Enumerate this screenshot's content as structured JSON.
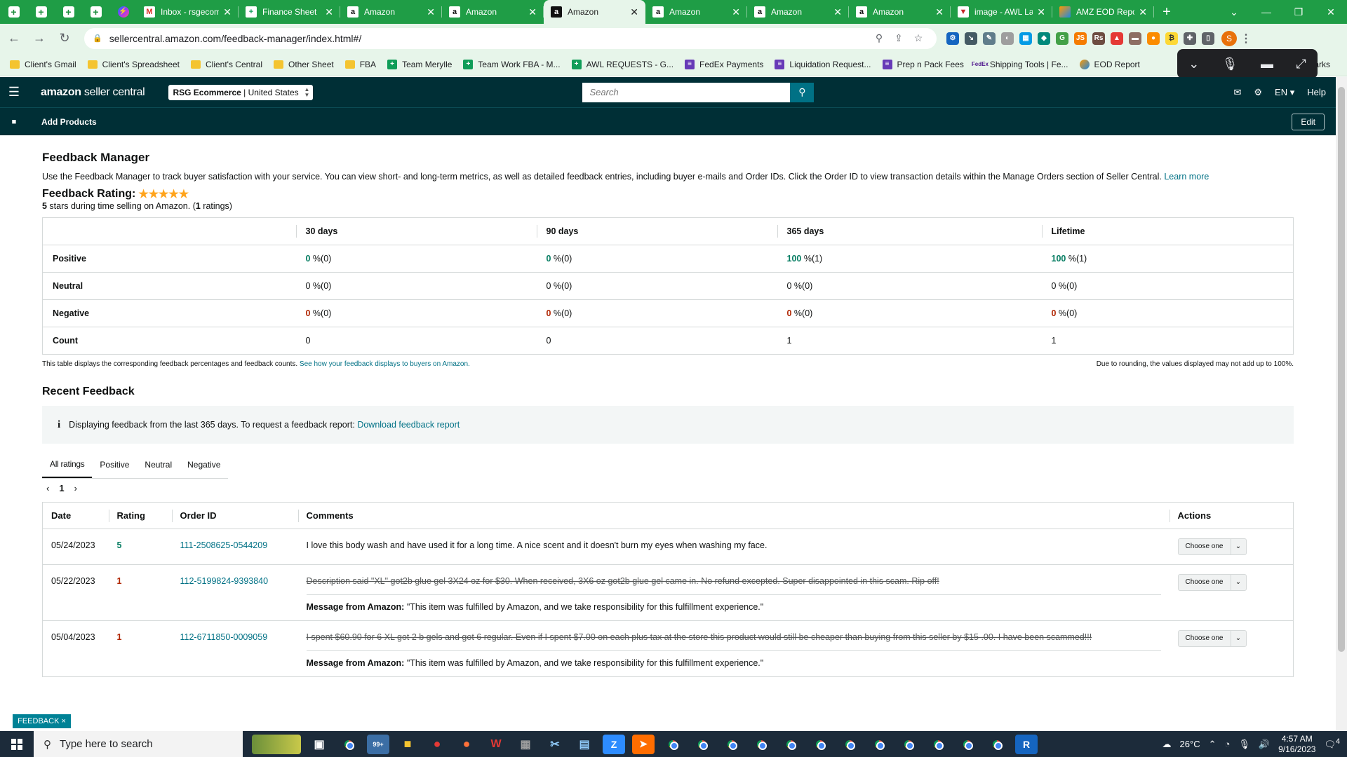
{
  "browser": {
    "pinned_tabs": [
      "sheet",
      "sheet",
      "sheet",
      "sheet",
      "messenger"
    ],
    "tabs": [
      {
        "title": "Inbox - rsgecom",
        "favicon": "gmail",
        "active": false
      },
      {
        "title": "Finance Sheet",
        "favicon": "sheet",
        "active": false
      },
      {
        "title": "Amazon",
        "favicon": "amazon",
        "active": false
      },
      {
        "title": "Amazon",
        "favicon": "amazon",
        "active": false
      },
      {
        "title": "Amazon",
        "favicon": "amazon",
        "active": true
      },
      {
        "title": "Amazon",
        "favicon": "amazon",
        "active": false
      },
      {
        "title": "Amazon",
        "favicon": "amazon",
        "active": false
      },
      {
        "title": "Amazon",
        "favicon": "amazon",
        "active": false
      },
      {
        "title": "image - AWL Labs",
        "favicon": "awl",
        "active": false
      },
      {
        "title": "AMZ EOD Report",
        "favicon": "multi",
        "active": false
      }
    ],
    "url": "sellercentral.amazon.com/feedback-manager/index.html#/",
    "profile_initial": "S",
    "bookmarks": [
      {
        "label": "Client's Gmail",
        "icon": "folder"
      },
      {
        "label": "Client's Spreadsheet",
        "icon": "folder"
      },
      {
        "label": "Client's Central",
        "icon": "folder"
      },
      {
        "label": "Other Sheet",
        "icon": "folder"
      },
      {
        "label": "FBA",
        "icon": "folder"
      },
      {
        "label": "Team Merylle",
        "icon": "sheet"
      },
      {
        "label": "Team Work FBA - M...",
        "icon": "sheet"
      },
      {
        "label": "AWL REQUESTS - G...",
        "icon": "sheet"
      },
      {
        "label": "FedEx Payments",
        "icon": "form"
      },
      {
        "label": "Liquidation Request...",
        "icon": "form"
      },
      {
        "label": "Prep n Pack Fees",
        "icon": "form"
      },
      {
        "label": "Shipping Tools | Fe...",
        "icon": "fedex"
      },
      {
        "label": "EOD Report",
        "icon": "eod"
      }
    ],
    "bookmarks_overflow": "marks"
  },
  "header": {
    "logo_bold": "amazon",
    "logo_rest": " seller central",
    "store": "RSG Ecommerce",
    "marketplace": "United States",
    "search_placeholder": "Search",
    "language": "EN",
    "help": "Help",
    "add_products": "Add Products",
    "edit": "Edit"
  },
  "feedback_manager": {
    "title": "Feedback Manager",
    "description": "Use the Feedback Manager to track buyer satisfaction with your service. You can view short- and long-term metrics, as well as detailed feedback entries, including buyer e-mails and Order IDs. Click the Order ID to view transaction details within the Manage Orders section of Seller Central.",
    "learn_more": "Learn more",
    "rating_label": "Feedback Rating:",
    "stars": "★★★★★",
    "rating_value": "5",
    "rating_mid": " stars during time selling on Amazon. (",
    "rating_count": "1",
    "rating_end": " ratings)",
    "columns": [
      "30 days",
      "90 days",
      "365 days",
      "Lifetime"
    ],
    "rows": [
      {
        "label": "Positive",
        "tone": "pos",
        "cells": [
          {
            "v": "0",
            "s": " %(0)"
          },
          {
            "v": "0",
            "s": " %(0)"
          },
          {
            "v": "100",
            "s": " %(1)"
          },
          {
            "v": "100",
            "s": " %(1)"
          }
        ]
      },
      {
        "label": "Neutral",
        "tone": "plain",
        "cells": [
          {
            "v": "0",
            "s": " %(0)"
          },
          {
            "v": "0",
            "s": " %(0)"
          },
          {
            "v": "0",
            "s": " %(0)"
          },
          {
            "v": "0",
            "s": " %(0)"
          }
        ]
      },
      {
        "label": "Negative",
        "tone": "neg",
        "cells": [
          {
            "v": "0",
            "s": " %(0)"
          },
          {
            "v": "0",
            "s": " %(0)"
          },
          {
            "v": "0",
            "s": " %(0)"
          },
          {
            "v": "0",
            "s": " %(0)"
          }
        ]
      },
      {
        "label": "Count",
        "tone": "plain",
        "cells": [
          {
            "v": "0",
            "s": ""
          },
          {
            "v": "0",
            "s": ""
          },
          {
            "v": "1",
            "s": ""
          },
          {
            "v": "1",
            "s": ""
          }
        ]
      }
    ],
    "note_left": "This table displays the corresponding feedback percentages and feedback counts.",
    "note_link": "See how your feedback displays to buyers on Amazon.",
    "note_right": "Due to rounding, the values displayed may not add up to 100%."
  },
  "recent": {
    "title": "Recent Feedback",
    "info_text": "Displaying feedback from the last 365 days. To request a feedback report:",
    "info_link": "Download feedback report",
    "tabs": [
      "All ratings",
      "Positive",
      "Neutral",
      "Negative"
    ],
    "page": "1",
    "columns": [
      "Date",
      "Rating",
      "Order ID",
      "Comments",
      "Actions"
    ],
    "rows": [
      {
        "date": "05/24/2023",
        "rating": "5",
        "tone": "pos",
        "order": "111-2508625-0544209",
        "comment": "I love this body wash and have used it for a long time. A nice scent and it doesn't burn my eyes when washing my face.",
        "struck": false,
        "amazon_label": "",
        "amazon_msg": "",
        "action": "Choose one"
      },
      {
        "date": "05/22/2023",
        "rating": "1",
        "tone": "neg",
        "order": "112-5199824-9393840",
        "comment": "Description said \"XL\" got2b glue gel 3X24 oz for $30. When received, 3X6 oz got2b glue gel came in. No refund excepted. Super disappointed in this scam. Rip off!",
        "struck": true,
        "amazon_label": "Message from Amazon:",
        "amazon_msg": " \"This item was fulfilled by Amazon, and we take responsibility for this fulfillment experience.\"",
        "action": "Choose one"
      },
      {
        "date": "05/04/2023",
        "rating": "1",
        "tone": "neg",
        "order": "112-6711850-0009059",
        "comment": "I spent $60.90 for 6 XL got 2 b gels and got 6 regular. Even if I spent $7.00 on each plus tax at the store this product would still be cheaper than buying from this seller by $15 .00. I have been scammed!!!",
        "struck": true,
        "amazon_label": "Message from Amazon:",
        "amazon_msg": " \"This item was fulfilled by Amazon, and we take responsibility for this fulfillment experience.\"",
        "action": "Choose one"
      }
    ],
    "feedback_tab": "FEEDBACK ×"
  },
  "taskbar": {
    "search_placeholder": "Type here to search",
    "badge": "99+",
    "weather": "26°C",
    "time": "4:57 AM",
    "date": "9/16/2023",
    "notif": "4"
  }
}
